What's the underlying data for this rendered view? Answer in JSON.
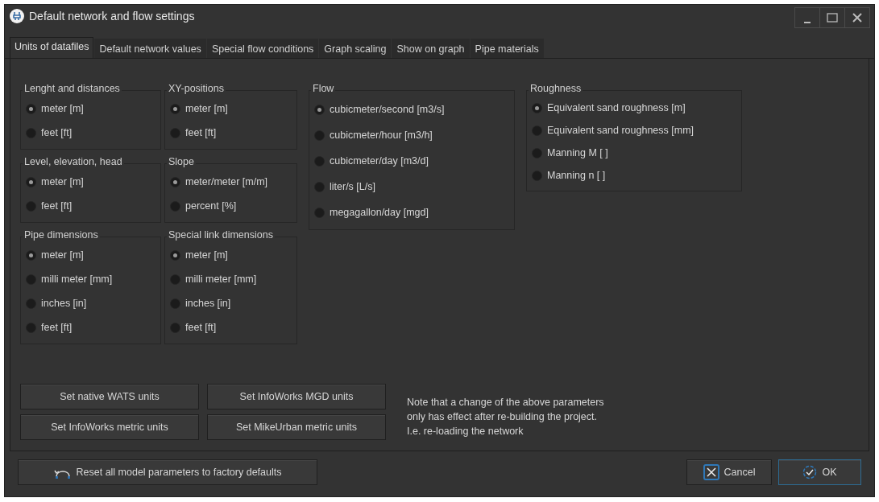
{
  "window": {
    "title": "Default network and flow settings"
  },
  "tabs": [
    {
      "label": "Units of datafiles",
      "selected": true
    },
    {
      "label": "Default network values",
      "selected": false
    },
    {
      "label": "Special flow conditions",
      "selected": false
    },
    {
      "label": "Graph scaling",
      "selected": false
    },
    {
      "label": "Show on graph",
      "selected": false
    },
    {
      "label": "Pipe materials",
      "selected": false
    }
  ],
  "left_groups": [
    {
      "title": "Lenght and distances",
      "options": [
        {
          "label": "meter [m]",
          "selected": true
        },
        {
          "label": "feet [ft]",
          "selected": false
        }
      ]
    },
    {
      "title": "XY-positions",
      "options": [
        {
          "label": "meter [m]",
          "selected": true
        },
        {
          "label": "feet [ft]",
          "selected": false
        }
      ]
    },
    {
      "title": "Level, elevation, head",
      "options": [
        {
          "label": "meter [m]",
          "selected": true
        },
        {
          "label": "feet [ft]",
          "selected": false
        }
      ]
    },
    {
      "title": "Slope",
      "options": [
        {
          "label": "meter/meter [m/m]",
          "selected": true
        },
        {
          "label": "percent [%]",
          "selected": false
        }
      ]
    },
    {
      "title": "Pipe dimensions",
      "options": [
        {
          "label": "meter [m]",
          "selected": true
        },
        {
          "label": "milli meter [mm]",
          "selected": false
        },
        {
          "label": "inches [in]",
          "selected": false
        },
        {
          "label": "feet [ft]",
          "selected": false
        }
      ]
    },
    {
      "title": "Special link dimensions",
      "options": [
        {
          "label": "meter [m]",
          "selected": true
        },
        {
          "label": "milli meter [mm]",
          "selected": false
        },
        {
          "label": "inches [in]",
          "selected": false
        },
        {
          "label": "feet [ft]",
          "selected": false
        }
      ]
    }
  ],
  "right_groups": [
    {
      "title": "Flow",
      "options": [
        {
          "label": "cubicmeter/second [m3/s]",
          "selected": true
        },
        {
          "label": "cubicmeter/hour [m3/h]",
          "selected": false
        },
        {
          "label": "cubicmeter/day [m3/d]",
          "selected": false
        },
        {
          "label": "liter/s [L/s]",
          "selected": false
        },
        {
          "label": "megagallon/day [mgd]",
          "selected": false
        }
      ]
    },
    {
      "title": "Roughness",
      "options": [
        {
          "label": "Equivalent sand roughness [m]",
          "selected": true
        },
        {
          "label": "Equivalent sand roughness [mm]",
          "selected": false
        },
        {
          "label": "Manning M [ ]",
          "selected": false
        },
        {
          "label": "Manning n [ ]",
          "selected": false
        }
      ]
    }
  ],
  "preset_buttons": [
    "Set native WATS units",
    "Set InfoWorks MGD units",
    "Set InfoWorks metric units",
    "Set MikeUrban metric units"
  ],
  "note": "Note that a change of the above parameters\nonly has effect after re-building the project.\nI.e. re-loading the network",
  "reset_button": "Reset all model parameters to factory defaults",
  "cancel_button": "Cancel",
  "ok_button": "OK"
}
